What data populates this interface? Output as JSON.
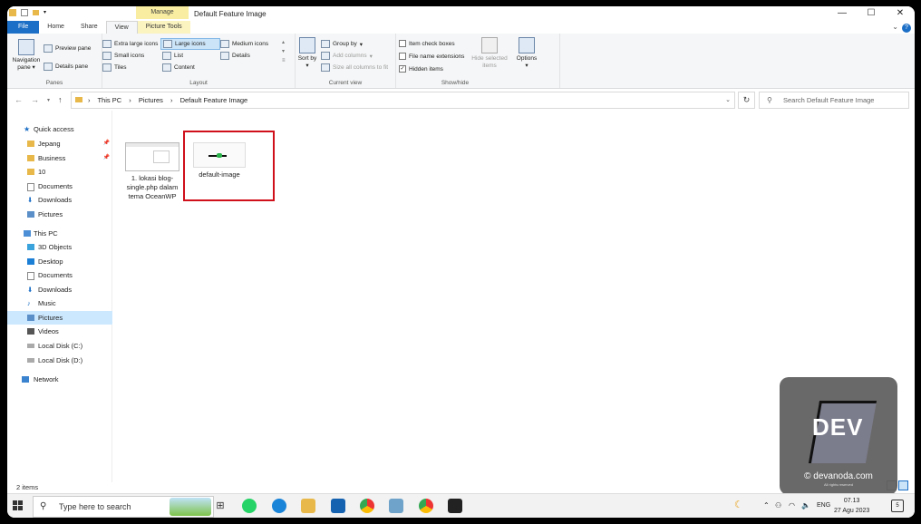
{
  "window": {
    "title": "Default Feature Image",
    "context_tab": "Manage",
    "controls": {
      "minimize": "—",
      "maximize": "☐",
      "close": "✕"
    }
  },
  "tabs": [
    "File",
    "Home",
    "Share",
    "View",
    "Picture Tools"
  ],
  "ribbon": {
    "panes": {
      "label": "Panes",
      "navigation_pane": "Navigation pane",
      "preview_pane": "Preview pane",
      "details_pane": "Details pane"
    },
    "layout": {
      "label": "Layout",
      "extra_large_icons": "Extra large icons",
      "large_icons": "Large icons",
      "medium_icons": "Medium icons",
      "small_icons": "Small icons",
      "list": "List",
      "details": "Details",
      "tiles": "Tiles",
      "content": "Content"
    },
    "current_view": {
      "label": "Current view",
      "sort_by": "Sort by",
      "group_by": "Group by",
      "add_columns": "Add columns",
      "size_all_columns": "Size all columns to fit"
    },
    "show_hide": {
      "label": "Show/hide",
      "item_check_boxes": "Item check boxes",
      "file_name_extensions": "File name extensions",
      "hidden_items": "Hidden items",
      "hide_selected": "Hide selected items",
      "options": "Options"
    }
  },
  "address": {
    "crumbs": [
      "This PC",
      "Pictures",
      "Default Feature Image"
    ],
    "search_placeholder": "Search Default Feature Image"
  },
  "nav_pane": {
    "quick_access": "Quick access",
    "quick_items": [
      "Jepang",
      "Business",
      "10",
      "Documents",
      "Downloads",
      "Pictures"
    ],
    "this_pc": "This PC",
    "pc_items": [
      "3D Objects",
      "Desktop",
      "Documents",
      "Downloads",
      "Music",
      "Pictures",
      "Videos",
      "Local Disk (C:)",
      "Local Disk (D:)"
    ],
    "network": "Network"
  },
  "files": [
    {
      "name": "1. lokasi blog-single.php dalam tema OceanWP"
    },
    {
      "name": "default-image"
    }
  ],
  "status": {
    "count": "2 items"
  },
  "watermark": {
    "brand": "DEV",
    "caption": "© devanoda.com",
    "sub": "All rights reserved"
  },
  "taskbar": {
    "search_placeholder": "Type here to search",
    "lang": "ENG",
    "time": "07.13",
    "date": "27 Agu 2023",
    "notifications": "5"
  },
  "colors": {
    "accent": "#1c6fc6",
    "selection_outline": "#d0101a",
    "manage_tab": "#f8eda0"
  }
}
